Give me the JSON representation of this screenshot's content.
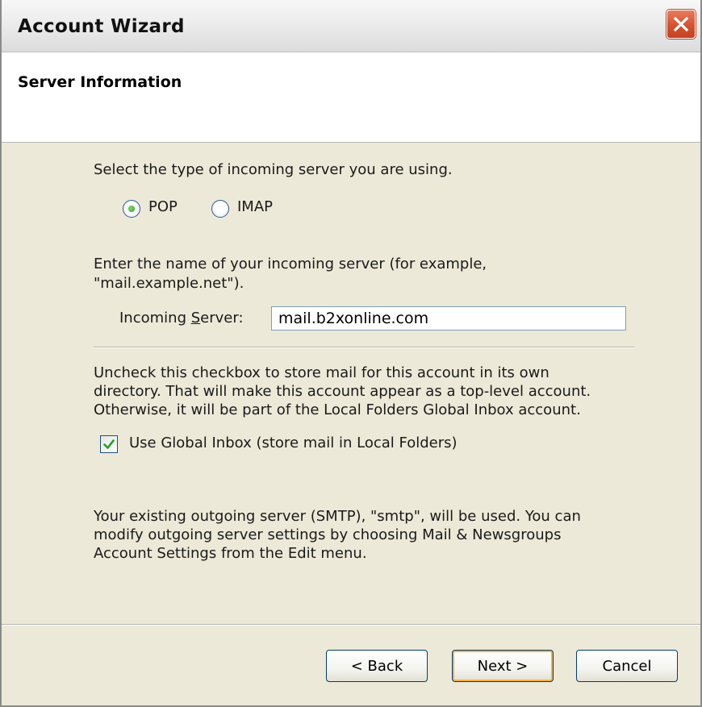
{
  "window": {
    "title": "Account Wizard",
    "close_icon": "close-icon"
  },
  "header": {
    "title": "Server Information"
  },
  "server_type": {
    "prompt": "Select the type of incoming server you are using.",
    "options": [
      {
        "label": "POP",
        "selected": true
      },
      {
        "label": "IMAP",
        "selected": false
      }
    ]
  },
  "incoming": {
    "prompt_line1": "Enter the name of your incoming server (for example,",
    "prompt_line2": "\"mail.example.net\").",
    "label_pre": "Incoming ",
    "label_accel": "S",
    "label_post": "erver:",
    "value": "mail.b2xonline.com"
  },
  "global_inbox": {
    "info_line1": "Uncheck this checkbox to store mail for this account in its own",
    "info_line2": "directory. That will make this account appear as a top-level account.",
    "info_line3": "Otherwise, it will be part of the Local Folders Global Inbox account.",
    "checkbox_label": "Use Global Inbox (store mail in Local Folders)",
    "checked": true
  },
  "outgoing": {
    "line1": "Your existing outgoing server (SMTP), \"smtp\", will be used. You can",
    "line2": "modify outgoing server settings by choosing Mail & Newsgroups",
    "line3": "Account Settings from the Edit menu."
  },
  "buttons": {
    "back": "< Back",
    "next": "Next >",
    "cancel": "Cancel"
  },
  "colors": {
    "dialog_bg": "#ece9d8",
    "close_button": "#d4532f",
    "radio_selected": "#2e9b22",
    "checkbox_check": "#21a121",
    "default_button_focus": "#f2b14a"
  }
}
